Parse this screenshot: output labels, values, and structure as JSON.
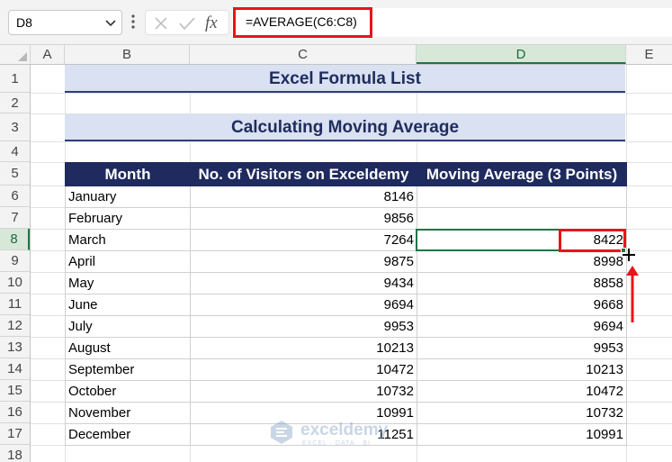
{
  "name_box": {
    "value": "D8"
  },
  "formula_bar": {
    "fx_label": "fx",
    "formula": "=AVERAGE(C6:C8)"
  },
  "columns": [
    "A",
    "B",
    "C",
    "D",
    "E"
  ],
  "active_column": "D",
  "rows": [
    "1",
    "2",
    "3",
    "4",
    "5",
    "6",
    "7",
    "8",
    "9",
    "10",
    "11",
    "12",
    "13",
    "14",
    "15",
    "16",
    "17",
    "18"
  ],
  "active_row": "8",
  "sheet": {
    "title": "Excel Formula List",
    "subtitle": "Calculating Moving Average"
  },
  "table": {
    "headers": [
      "Month",
      "No. of Visitors on Exceldemy",
      "Moving Average (3 Points)"
    ],
    "rows": [
      {
        "month": "January",
        "visitors": "8146",
        "moving_avg": ""
      },
      {
        "month": "February",
        "visitors": "9856",
        "moving_avg": ""
      },
      {
        "month": "March",
        "visitors": "7264",
        "moving_avg": "8422"
      },
      {
        "month": "April",
        "visitors": "9875",
        "moving_avg": "8998"
      },
      {
        "month": "May",
        "visitors": "9434",
        "moving_avg": "8858"
      },
      {
        "month": "June",
        "visitors": "9694",
        "moving_avg": "9668"
      },
      {
        "month": "July",
        "visitors": "9953",
        "moving_avg": "9694"
      },
      {
        "month": "August",
        "visitors": "10213",
        "moving_avg": "9953"
      },
      {
        "month": "September",
        "visitors": "10472",
        "moving_avg": "10213"
      },
      {
        "month": "October",
        "visitors": "10732",
        "moving_avg": "10472"
      },
      {
        "month": "November",
        "visitors": "10991",
        "moving_avg": "10732"
      },
      {
        "month": "December",
        "visitors": "11251",
        "moving_avg": "10991"
      }
    ]
  },
  "watermark": {
    "name": "exceldemy",
    "tagline": "EXCEL · DATA · BI"
  },
  "colors": {
    "header_fill": "#1f2b5e",
    "title_band": "#d9e1f2",
    "highlight_red": "#e8141c",
    "excel_green": "#217346"
  },
  "icons": [
    "chevron-down-icon",
    "more-options-icon",
    "cancel-icon",
    "enter-icon",
    "fill-cursor-icon",
    "up-arrow-icon",
    "exceldemy-logo-icon"
  ]
}
